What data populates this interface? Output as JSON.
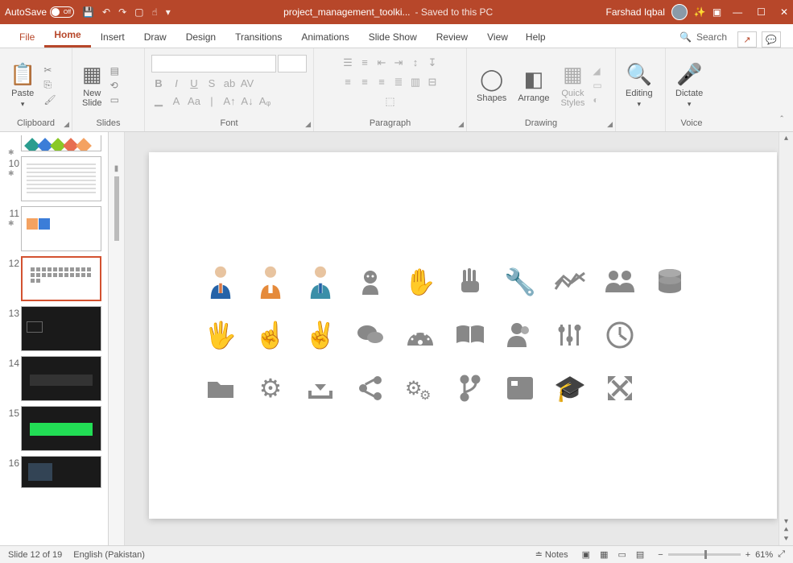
{
  "titlebar": {
    "autosave_label": "AutoSave",
    "autosave_state": "Off",
    "doc_name": "project_management_toolki...",
    "save_status": "- Saved to this PC",
    "user_name": "Farshad Iqbal"
  },
  "tabs": {
    "file": "File",
    "items": [
      "Home",
      "Insert",
      "Draw",
      "Design",
      "Transitions",
      "Animations",
      "Slide Show",
      "Review",
      "View",
      "Help"
    ],
    "active": "Home",
    "search": "Search"
  },
  "ribbon": {
    "clipboard": {
      "label": "Clipboard",
      "paste": "Paste"
    },
    "slides": {
      "label": "Slides",
      "new_slide": "New\nSlide"
    },
    "font": {
      "label": "Font"
    },
    "paragraph": {
      "label": "Paragraph"
    },
    "drawing": {
      "label": "Drawing",
      "shapes": "Shapes",
      "arrange": "Arrange",
      "quick_styles": "Quick\nStyles"
    },
    "editing": {
      "label": "Editing",
      "btn": "Editing"
    },
    "voice": {
      "label": "Voice",
      "dictate": "Dictate"
    }
  },
  "thumbs": {
    "numbers": [
      "10",
      "11",
      "12",
      "13",
      "14",
      "15",
      "16"
    ],
    "current": "12"
  },
  "statusbar": {
    "slide_info": "Slide 12 of 19",
    "language": "English (Pakistan)",
    "notes": "Notes",
    "zoom": "61%"
  },
  "slide_icons": {
    "row1": [
      "person-blue",
      "person-orange",
      "person-teal",
      "child",
      "hand-four",
      "hand-three",
      "wrench",
      "chart-line",
      "users",
      "database"
    ],
    "row2": [
      "hand-five",
      "hand-point",
      "hand-peace",
      "chat",
      "gauge",
      "book",
      "user-pair",
      "sliders",
      "clock",
      ""
    ],
    "row3": [
      "folder",
      "gear",
      "download",
      "share",
      "gears",
      "branch",
      "news",
      "graduation",
      "expand",
      ""
    ]
  }
}
